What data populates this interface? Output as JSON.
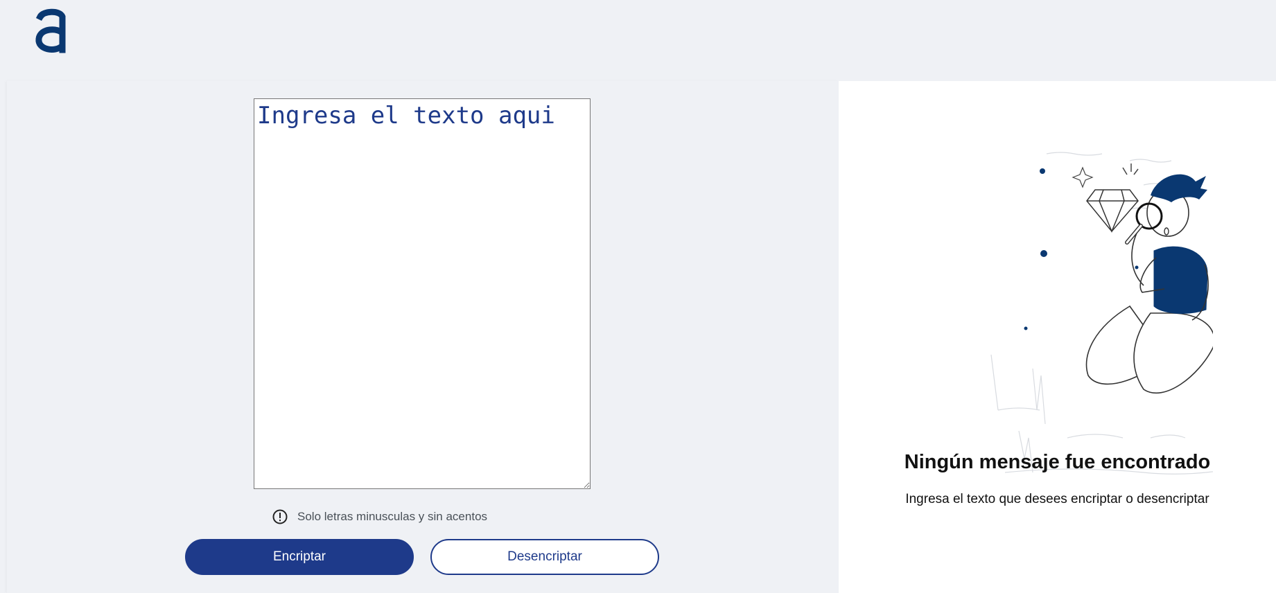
{
  "header": {
    "logo_icon": "alura-a-logo-icon",
    "brand_color": "#0a3871"
  },
  "editor": {
    "placeholder": "Ingresa el texto aqui",
    "value": ""
  },
  "hint": {
    "icon": "exclamation-circle-icon",
    "text": "Solo letras minusculas y sin acentos"
  },
  "actions": {
    "encrypt_label": "Encriptar",
    "decrypt_label": "Desencriptar",
    "primary_color": "#1e3a8a"
  },
  "result": {
    "illustration": "person-with-magnifying-glass-illustration",
    "title": "Ningún mensaje fue encontrado",
    "subtitle": "Ingresa el texto que desees encriptar o desencriptar"
  }
}
